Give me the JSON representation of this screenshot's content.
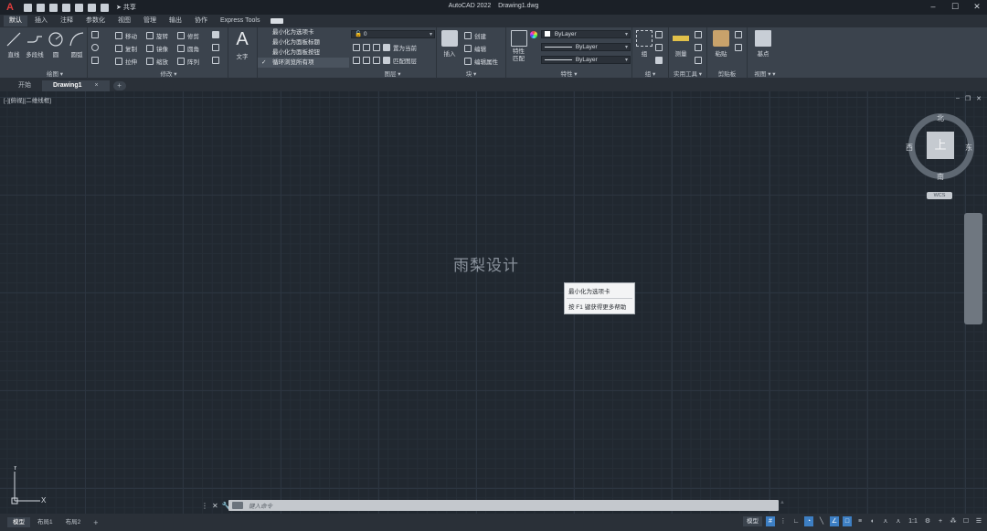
{
  "titlebar": {
    "logo": "A",
    "share_label": "共享",
    "app_title": "AutoCAD 2022",
    "file_title": "Drawing1.dwg"
  },
  "ribbon_tabs": [
    "默认",
    "插入",
    "注释",
    "参数化",
    "视图",
    "管理",
    "输出",
    "协作",
    "Express Tools"
  ],
  "ribbon": {
    "draw": {
      "title": "绘图 ▾",
      "line": "直线",
      "polyline": "多段线",
      "circle": "圆",
      "arc": "圆弧"
    },
    "modify": {
      "title": "修改 ▾",
      "move": "移动",
      "rotate": "旋转",
      "trim": "修剪",
      "copy": "复制",
      "mirror": "镜像",
      "fillet": "圆角",
      "stretch": "拉伸",
      "scale": "缩放",
      "array": "阵列"
    },
    "annotation": {
      "text": "文字"
    },
    "popup": {
      "items": [
        "最小化为选项卡",
        "最小化为面板标题",
        "最小化为面板按钮",
        "循环浏览所有项"
      ]
    },
    "layers": {
      "title": "图层 ▾",
      "layer_value": "0",
      "make_current": "置为当前",
      "match_layer": "匹配图层"
    },
    "block": {
      "title": "块 ▾",
      "insert": "插入",
      "create": "创建",
      "edit": "编辑",
      "edit_attributes": "编辑属性"
    },
    "properties": {
      "title": "特性 ▾",
      "match": "特性匹配",
      "color": "ByLayer",
      "linetype": "ByLayer",
      "lineweight": "ByLayer"
    },
    "groups": {
      "title": "组 ▾",
      "group": "组"
    },
    "utilities": {
      "title": "实用工具 ▾",
      "measure": "测量"
    },
    "clipboard": {
      "title": "剪贴板",
      "paste": "粘贴"
    },
    "view": {
      "title": "视图 ▾ ▾",
      "base": "基点"
    }
  },
  "doc_tabs": {
    "start": "开始",
    "active": "Drawing1",
    "close": "×",
    "add": "+"
  },
  "viewport": {
    "label": "[-][俯视][二维线框]",
    "watermark": "雨梨设计"
  },
  "viewcube": {
    "north": "北",
    "south": "南",
    "east": "东",
    "west": "西",
    "top": "上",
    "wcs": "WCS"
  },
  "tooltip": {
    "line1": "最小化为选项卡",
    "line2": "按 F1 键获得更多帮助"
  },
  "ucs": {
    "x": "X",
    "y": "Y"
  },
  "command": {
    "placeholder": "键入命令"
  },
  "layout_tabs": [
    "模型",
    "布局1",
    "布局2"
  ],
  "status": {
    "model": "模型",
    "scale": "1:1"
  }
}
